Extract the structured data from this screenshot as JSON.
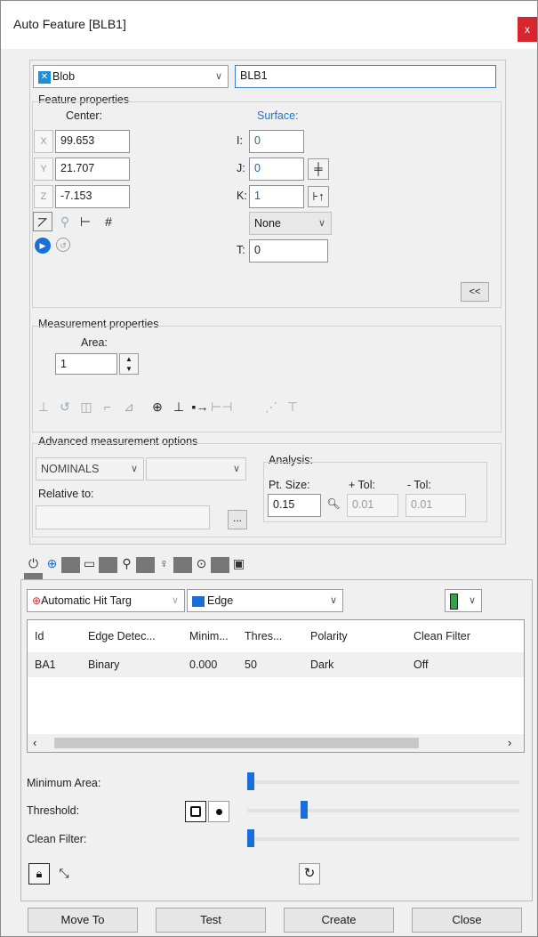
{
  "window": {
    "title": "Auto Feature [BLB1]",
    "close": "x"
  },
  "feature_type": {
    "value": "Blob",
    "icon": "blob-icon"
  },
  "feature_id": "BLB1",
  "feature_properties": {
    "title": "Feature properties",
    "center_label": "Center:",
    "axis_labels": [
      "X",
      "Y",
      "Z"
    ],
    "x": "99.653",
    "y": "21.707",
    "z": "-7.153",
    "surface_label": "Surface:",
    "i_label": "I:",
    "i": "0",
    "j_label": "J:",
    "j": "0",
    "k_label": "K:",
    "k": "1",
    "surface_mode": "None",
    "t_label": "T:",
    "t": "0",
    "collapse_button": "<<"
  },
  "measurement_properties": {
    "title": "Measurement properties",
    "area_label": "Area:",
    "area_value": "1"
  },
  "advanced": {
    "title": "Advanced measurement options",
    "nominals": "NOMINALS",
    "relative_label": "Relative to:",
    "browse": "...",
    "analysis_label": "Analysis:",
    "pt_size_label": "Pt. Size:",
    "pt_size": "0.15",
    "plus_tol_label": "+ Tol:",
    "plus_tol": "0.01",
    "minus_tol_label": "- Tol:",
    "minus_tol": "0.01"
  },
  "hit_target": {
    "mode": "Automatic Hit Targ",
    "edge_type": "Edge"
  },
  "table": {
    "columns": [
      "Id",
      "Edge Detec...",
      "Minim...",
      "Thres...",
      "Polarity",
      "Clean Filter"
    ],
    "rows": [
      [
        "BA1",
        "Binary",
        "0.000",
        "50",
        "Dark",
        "Off"
      ]
    ]
  },
  "sliders": {
    "minimum_area_label": "Minimum Area:",
    "minimum_area_level": 0,
    "threshold_label": "Threshold:",
    "threshold_level": 0.2,
    "clean_filter_label": "Clean Filter:",
    "clean_filter_level": 0
  },
  "buttons": {
    "move_to": "Move To",
    "test": "Test",
    "create": "Create",
    "close": "Close"
  },
  "colors": {
    "accent": "#1a6fd6",
    "close_red": "#d8252e",
    "surface_blue": "#1e73c8"
  }
}
